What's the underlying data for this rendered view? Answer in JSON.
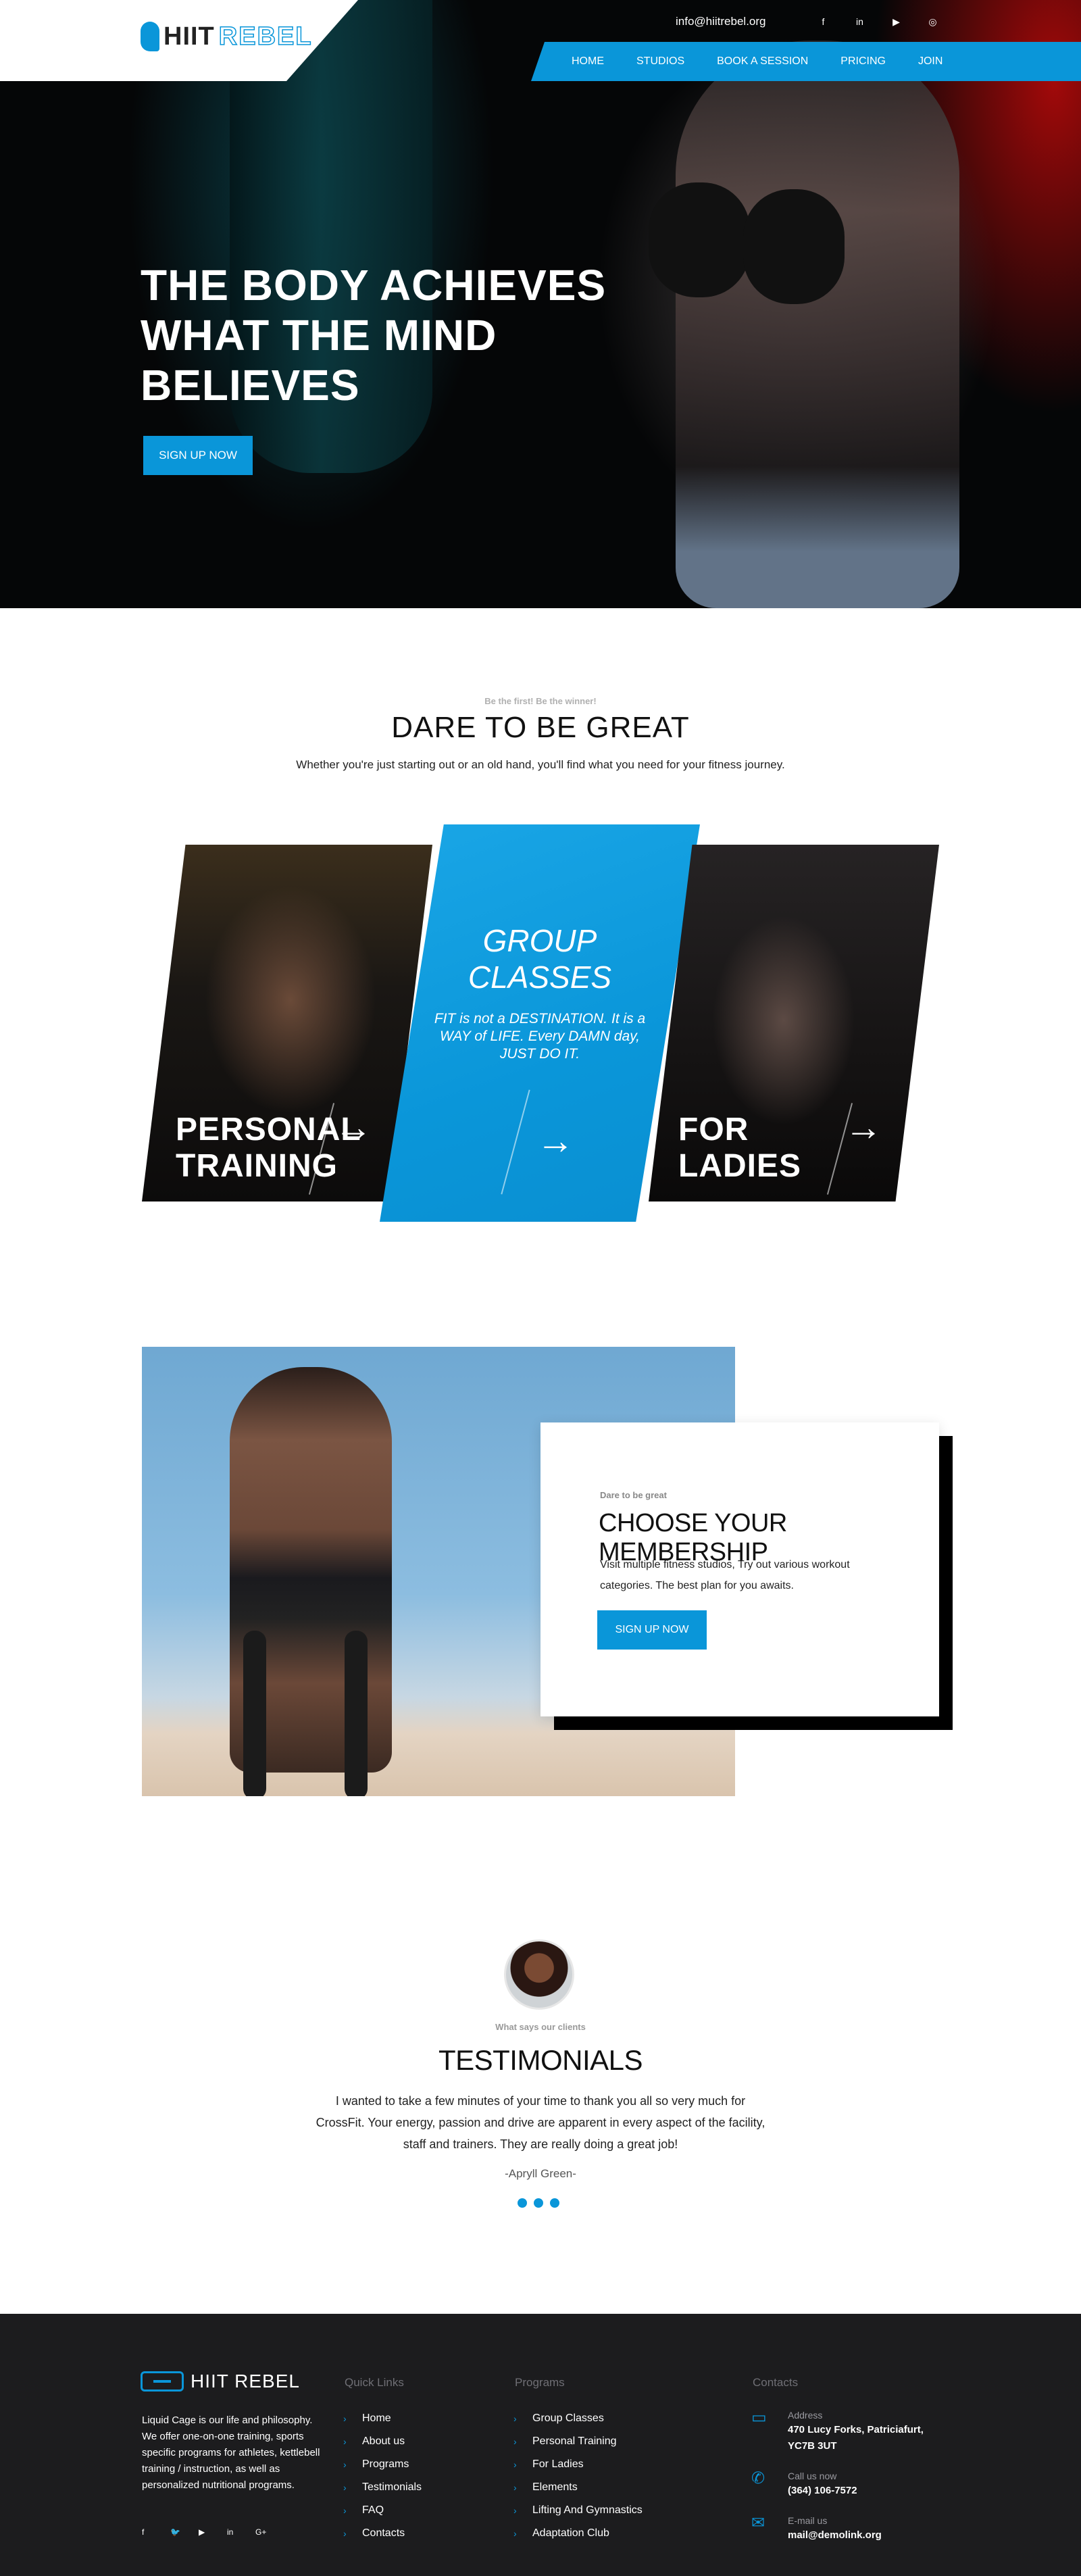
{
  "brand": {
    "name_part1": "HIIT",
    "name_part2": "REBEL",
    "footer_name": "HIIT REBEL"
  },
  "topbar": {
    "email": "info@hiitrebel.org",
    "social": [
      {
        "icon": "facebook-icon",
        "glyph": "f"
      },
      {
        "icon": "linkedin-icon",
        "glyph": "in"
      },
      {
        "icon": "youtube-icon",
        "glyph": "▶"
      },
      {
        "icon": "instagram-icon",
        "glyph": "◎"
      }
    ]
  },
  "nav": {
    "items": [
      "HOME",
      "STUDIOS",
      "BOOK A SESSION",
      "PRICING",
      "JOIN"
    ]
  },
  "hero": {
    "title_line1": "THE BODY ACHIEVES",
    "title_line2": "WHAT THE MIND",
    "title_line3": "BELIEVES",
    "cta": "SIGN UP NOW"
  },
  "dare": {
    "kicker": "Be the first! Be the winner!",
    "title": "DARE TO BE GREAT",
    "subtitle": "Whether you're just starting out or an old hand, you'll find what you need for your fitness journey."
  },
  "cards": {
    "personal": {
      "line1": "PERSONAL",
      "line2": "TRAINING"
    },
    "group": {
      "line1": "GROUP",
      "line2": "CLASSES",
      "tagline": "FIT is not a DESTINATION. It is a WAY of LIFE. Every DAMN day, JUST DO IT."
    },
    "ladies": {
      "line1": "FOR",
      "line2": "LADIES"
    },
    "arrow": "→"
  },
  "membership": {
    "kicker": "Dare to be great",
    "title": "CHOOSE YOUR MEMBERSHIP",
    "text": "Visit multiple fitness studios, Try out various workout categories. The best plan for you awaits.",
    "cta": "SIGN UP NOW"
  },
  "testimonials": {
    "kicker": "What says our clients",
    "title": "TESTIMONIALS",
    "quote": "I wanted to take a few minutes of your time to thank you all so very much for CrossFit.  Your energy, passion and drive are apparent in every aspect of the facility, staff and trainers. They are really doing a great job!",
    "author": "-Apryll Green-"
  },
  "footer": {
    "about": "Liquid Cage is our life and philosophy. We offer one-on-one training, sports specific programs for athletes, kettlebell training / instruction, as well as personalized nutritional programs.",
    "social": [
      "f",
      "🐦",
      "▶",
      "in",
      "G+"
    ],
    "quick_links_title": "Quick Links",
    "quick_links": [
      "Home",
      "About us",
      "Programs",
      "Testimonials",
      "FAQ",
      "Contacts"
    ],
    "programs_title": "Programs",
    "programs": [
      "Group Classes",
      "Personal Training",
      "For Ladies",
      "Elements",
      "Lifting And Gymnastics",
      "Adaptation Club"
    ],
    "contacts_title": "Contacts",
    "address_label": "Address",
    "address": "470 Lucy Forks, Patriciafurt, YC7B 3UT",
    "phone_label": "Call us now",
    "phone": "(364) 106-7572",
    "email_label": "E-mail us",
    "email": "mail@demolink.org"
  },
  "colors": {
    "accent": "#0a96d9",
    "footer_bg": "#1c1c1e",
    "hero_bg": "#050607"
  }
}
